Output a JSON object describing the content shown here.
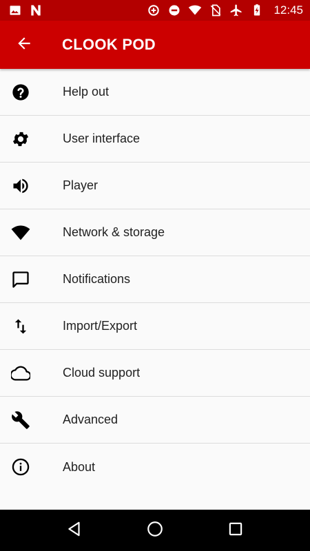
{
  "status_bar": {
    "time": "12:45",
    "left_icons": [
      "image-icon",
      "notification-n-icon"
    ],
    "right_icons": [
      "data-saver-icon",
      "do-not-disturb-icon",
      "wifi-icon",
      "no-sim-icon",
      "airplane-mode-icon",
      "battery-charging-icon"
    ]
  },
  "app_bar": {
    "title": "CLOOK POD",
    "back_icon": "arrow-back-icon",
    "color": "#cc0000"
  },
  "settings": {
    "items": [
      {
        "label": "Help out",
        "icon": "help-circle-icon"
      },
      {
        "label": "User interface",
        "icon": "gear-icon"
      },
      {
        "label": "Player",
        "icon": "volume-icon"
      },
      {
        "label": "Network & storage",
        "icon": "wifi-icon"
      },
      {
        "label": "Notifications",
        "icon": "chat-bubble-icon"
      },
      {
        "label": "Import/Export",
        "icon": "swap-vertical-icon"
      },
      {
        "label": "Cloud support",
        "icon": "cloud-icon"
      },
      {
        "label": "Advanced",
        "icon": "wrench-icon"
      },
      {
        "label": "About",
        "icon": "info-icon"
      }
    ]
  },
  "nav_bar": {
    "icons": [
      "back-triangle-icon",
      "home-circle-icon",
      "recents-square-icon"
    ]
  }
}
